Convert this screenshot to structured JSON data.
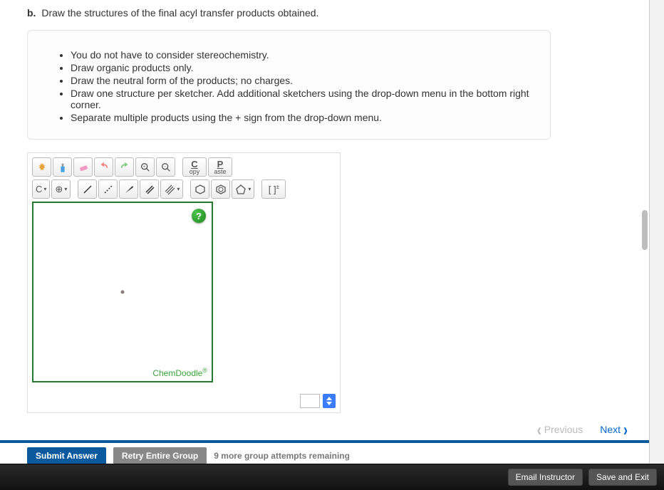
{
  "question": {
    "label": "b.",
    "text": "Draw the structures of the final acyl transfer products obtained."
  },
  "hints": [
    "You do not have to consider stereochemistry.",
    "Draw organic products only.",
    "Draw the neutral form of the products; no charges.",
    "Draw one structure per sketcher. Add additional sketchers using the drop-down menu in the bottom right corner.",
    "Separate multiple products using the + sign from the drop-down menu."
  ],
  "toolbar": {
    "copy_big": "C",
    "copy_small": "opy",
    "paste_big": "P",
    "paste_small": "aste",
    "elem_label": "C",
    "caret": "▾",
    "plus_circle": "⊕"
  },
  "canvas": {
    "help": "?",
    "brand": "ChemDoodle",
    "brand_sup": "®"
  },
  "nav": {
    "previous": "Previous",
    "next": "Next"
  },
  "actions": {
    "submit": "Submit Answer",
    "retry": "Retry Entire Group",
    "attempts": "9 more group attempts remaining"
  },
  "footer": {
    "email": "Email Instructor",
    "save": "Save and Exit"
  }
}
